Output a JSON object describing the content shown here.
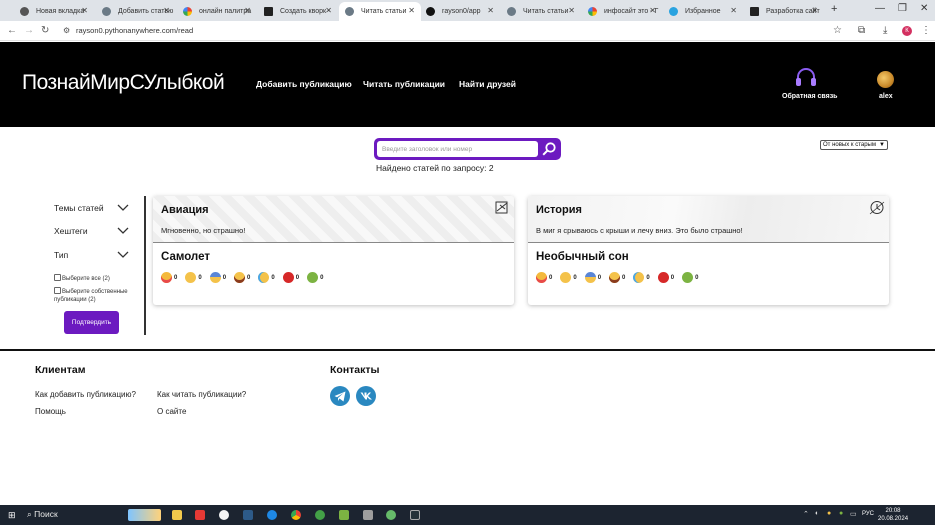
{
  "browser": {
    "tabs": [
      {
        "label": "Новая вкладка",
        "icon": "globe-icon"
      },
      {
        "label": "Добавить статью",
        "icon": "site-icon"
      },
      {
        "label": "онлайн палитра",
        "icon": "google-icon"
      },
      {
        "label": "Создать кворк -",
        "icon": "kwork-icon"
      },
      {
        "label": "Читать статьи",
        "icon": "site-icon"
      },
      {
        "label": "rayson0/app",
        "icon": "github-icon"
      },
      {
        "label": "Читать статьи",
        "icon": "site-icon"
      },
      {
        "label": "инфосайт это - Г",
        "icon": "google-icon"
      },
      {
        "label": "Избранное",
        "icon": "telegram-icon"
      },
      {
        "label": "Разработка сайт",
        "icon": "kwork-icon"
      }
    ],
    "active_tab": 4,
    "url": "rayson0.pythonanywhere.com/read",
    "profile_initial": "К"
  },
  "site": {
    "logo": "ПознайМирСУлыбкой",
    "nav": [
      "Добавить публикацию",
      "Читать публикации",
      "Найти друзей"
    ],
    "feedback": "Обратная связь",
    "user": "alex",
    "accent_color": "#6c1ac0"
  },
  "search": {
    "placeholder": "Введите заголовок или номер",
    "found_text": "Найдено статей по запросу: 2",
    "sort_selected": "От новых к старым"
  },
  "filters": {
    "groups": [
      "Темы статей",
      "Хештеги",
      "Тип"
    ],
    "checks": [
      {
        "label": "Выберите все (2)"
      },
      {
        "label": "Выберите собственные публикации (2)"
      }
    ],
    "confirm": "Подтвердить"
  },
  "articles": [
    {
      "topic": "Авиация",
      "topic_icon": "airplane-icon",
      "excerpt": "Мгновенно, но страшно!",
      "title": "Самолет",
      "reactions": [
        {
          "icon": "heart-eyes-emoji",
          "count": "0"
        },
        {
          "icon": "smile-emoji",
          "count": "0"
        },
        {
          "icon": "scared-emoji",
          "count": "0"
        },
        {
          "icon": "laughing-emoji",
          "count": "0"
        },
        {
          "icon": "crying-emoji",
          "count": "0"
        },
        {
          "icon": "angry-emoji",
          "count": "0"
        },
        {
          "icon": "sick-emoji",
          "count": "0"
        }
      ]
    },
    {
      "topic": "История",
      "topic_icon": "history-icon",
      "excerpt": "В миг я срываюсь с крыши и лечу вниз. Это было страшно!",
      "title": "Необычный сон",
      "reactions": [
        {
          "icon": "heart-eyes-emoji",
          "count": "0"
        },
        {
          "icon": "smile-emoji",
          "count": "0"
        },
        {
          "icon": "scared-emoji",
          "count": "0"
        },
        {
          "icon": "laughing-emoji",
          "count": "0"
        },
        {
          "icon": "crying-emoji",
          "count": "0"
        },
        {
          "icon": "angry-emoji",
          "count": "0"
        },
        {
          "icon": "sick-emoji",
          "count": "0"
        }
      ]
    }
  ],
  "footer": {
    "clients_heading": "Клиентам",
    "contacts_heading": "Контакты",
    "links": [
      "Как добавить публикацию?",
      "Как читать публикации?",
      "Помощь",
      "О сайте"
    ],
    "social": [
      "telegram-icon",
      "vk-icon"
    ]
  },
  "taskbar": {
    "search": "Поиск",
    "lang": "РУС",
    "time": "20:08",
    "date": "20.08.2024"
  }
}
